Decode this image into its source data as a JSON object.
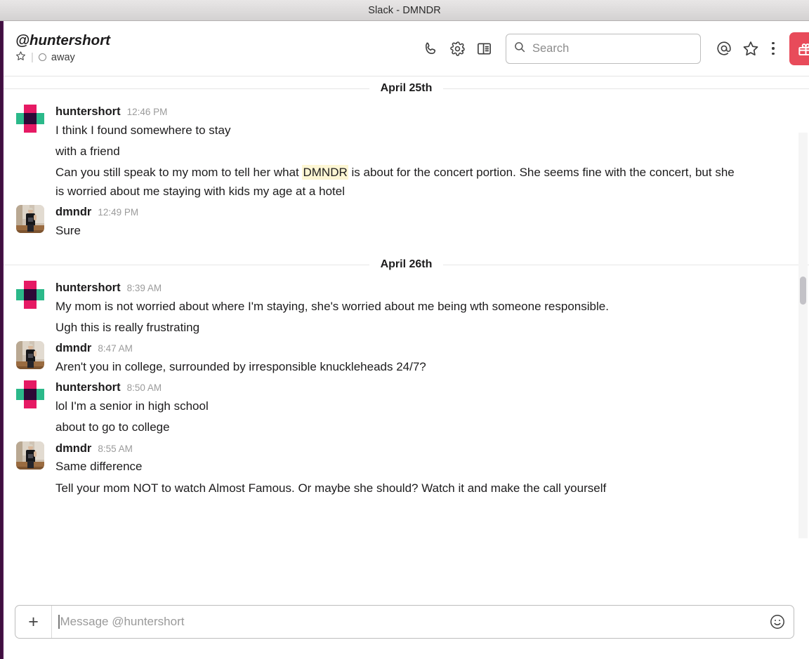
{
  "window": {
    "title": "Slack - DMNDR"
  },
  "header": {
    "channel_name": "@huntershort",
    "star_icon": "star-outline-icon",
    "meta_divider": "|",
    "presence_icon": "away-circle-icon",
    "presence_label": "away",
    "actions": [
      {
        "name": "call-button",
        "icon": "phone-icon"
      },
      {
        "name": "settings-button",
        "icon": "gear-icon"
      },
      {
        "name": "details-panel-button",
        "icon": "sidebar-panel-icon"
      }
    ],
    "search": {
      "icon": "search-icon",
      "placeholder": "Search",
      "value": ""
    },
    "right_actions": [
      {
        "name": "mentions-button",
        "icon": "at-sign-icon"
      },
      {
        "name": "starred-button",
        "icon": "star-outline-icon"
      },
      {
        "name": "more-options-button",
        "icon": "kebab-menu-icon"
      }
    ],
    "gift_button": {
      "icon": "gift-icon",
      "color": "#e84b5a"
    }
  },
  "conversation": {
    "highlight_color": "#fdf6d3",
    "days": [
      {
        "date_label": "April 25th",
        "groups": [
          {
            "author": "huntershort",
            "time": "12:46 PM",
            "avatar": "logo",
            "lines": [
              {
                "text": "I think I found somewhere to stay"
              },
              {
                "text": "with a friend"
              },
              {
                "pre": "Can you still speak to my mom to tell her what ",
                "highlight": "DMNDR",
                "post": " is about for the concert portion. She seems fine with the concert, but she is worried about me staying with kids my age at a hotel"
              }
            ]
          },
          {
            "author": "dmndr",
            "time": "12:49 PM",
            "avatar": "photo",
            "lines": [
              {
                "text": "Sure"
              }
            ]
          }
        ]
      },
      {
        "date_label": "April 26th",
        "groups": [
          {
            "author": "huntershort",
            "time": "8:39 AM",
            "avatar": "logo",
            "lines": [
              {
                "text": "My mom is not worried about where I'm staying, she's worried about me being wth someone responsible."
              },
              {
                "text": "Ugh this is really frustrating"
              }
            ]
          },
          {
            "author": "dmndr",
            "time": "8:47 AM",
            "avatar": "photo",
            "lines": [
              {
                "text": "Aren't you in college, surrounded by irresponsible knuckleheads 24/7?"
              }
            ]
          },
          {
            "author": "huntershort",
            "time": "8:50 AM",
            "avatar": "logo",
            "lines": [
              {
                "text": "lol I'm a senior in high school"
              },
              {
                "text": "about to go to college"
              }
            ]
          },
          {
            "author": "dmndr",
            "time": "8:55 AM",
            "avatar": "photo",
            "lines": [
              {
                "text": "Same difference"
              },
              {
                "text": "Tell your mom NOT to watch Almost Famous. Or maybe she should? Watch it and make the call yourself"
              }
            ]
          }
        ]
      }
    ]
  },
  "composer": {
    "add_label": "+",
    "placeholder": "Message @huntershort",
    "value": "",
    "emoji_icon": "smiley-face-icon"
  }
}
